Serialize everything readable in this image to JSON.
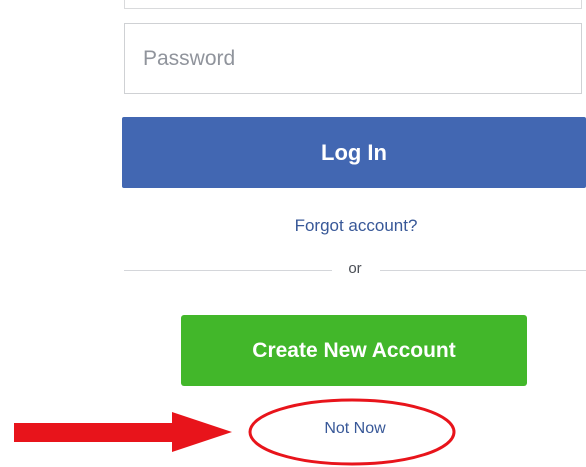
{
  "login_form": {
    "password_placeholder": "Password",
    "password_value": "",
    "login_label": "Log In",
    "forgot_label": "Forgot account?",
    "divider_label": "or",
    "create_label": "Create New Account",
    "not_now_label": "Not Now"
  },
  "colors": {
    "login_button": "#4267b2",
    "create_button": "#42b72a",
    "link": "#385898",
    "annotation": "#e8141b"
  },
  "annotation": {
    "arrow_icon": "red-arrow-icon",
    "highlight_shape": "red-ellipse"
  }
}
